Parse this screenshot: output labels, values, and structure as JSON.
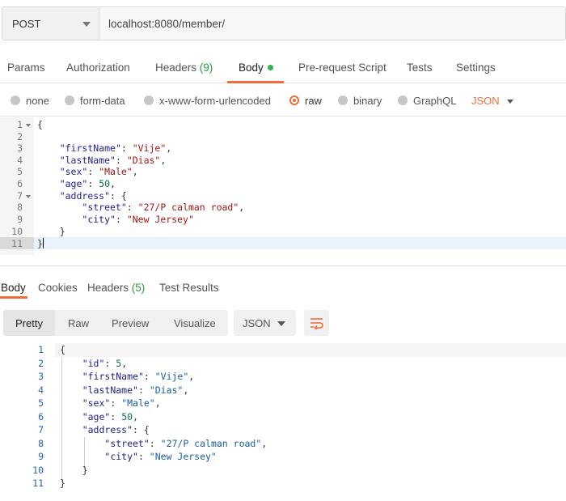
{
  "request": {
    "method": "POST",
    "url": "localhost:8080/member/"
  },
  "tabs": [
    {
      "label": "Params"
    },
    {
      "label": "Authorization"
    },
    {
      "label": "Headers",
      "count": "(9)"
    },
    {
      "label": "Body"
    },
    {
      "label": "Pre-request Script"
    },
    {
      "label": "Tests"
    },
    {
      "label": "Settings"
    }
  ],
  "body_types": {
    "options": [
      "none",
      "form-data",
      "x-www-form-urlencoded",
      "raw",
      "binary",
      "GraphQL"
    ],
    "selected": "raw",
    "format": "JSON"
  },
  "request_body": {
    "line_numbers": [
      "1",
      "2",
      "3",
      "4",
      "5",
      "6",
      "7",
      "8",
      "9",
      "10",
      "11"
    ],
    "lines": [
      "{",
      "",
      "    \"firstName\": \"Vije\",",
      "    \"lastName\": \"Dias\",",
      "    \"sex\": \"Male\",",
      "    \"age\": 50,",
      "    \"address\": {",
      "        \"street\": \"27/P calman road\",",
      "        \"city\": \"New Jersey\"",
      "    }",
      "}"
    ]
  },
  "response_tabs": [
    {
      "label": "Body"
    },
    {
      "label": "Cookies"
    },
    {
      "label": "Headers",
      "count": "(5)"
    },
    {
      "label": "Test Results"
    }
  ],
  "response_toolbar": {
    "formats": [
      "Pretty",
      "Raw",
      "Preview",
      "Visualize"
    ],
    "language": "JSON"
  },
  "response_body": {
    "line_numbers": [
      "1",
      "2",
      "3",
      "4",
      "5",
      "6",
      "7",
      "8",
      "9",
      "10",
      "11"
    ],
    "lines": [
      "{",
      "    \"id\": 5,",
      "    \"firstName\": \"Vije\",",
      "    \"lastName\": \"Dias\",",
      "    \"sex\": \"Male\",",
      "    \"age\": 50,",
      "    \"address\": {",
      "        \"street\": \"27/P calman road\",",
      "        \"city\": \"New Jersey\"",
      "    }",
      "}"
    ]
  },
  "colors": {
    "accent": "#f26b3a",
    "count_green": "#2b9a3c",
    "dot_green": "#32b34a",
    "key_blue": "#1f1f8f",
    "string_red": "#a31515",
    "string_blue": "#1a5ea8"
  }
}
